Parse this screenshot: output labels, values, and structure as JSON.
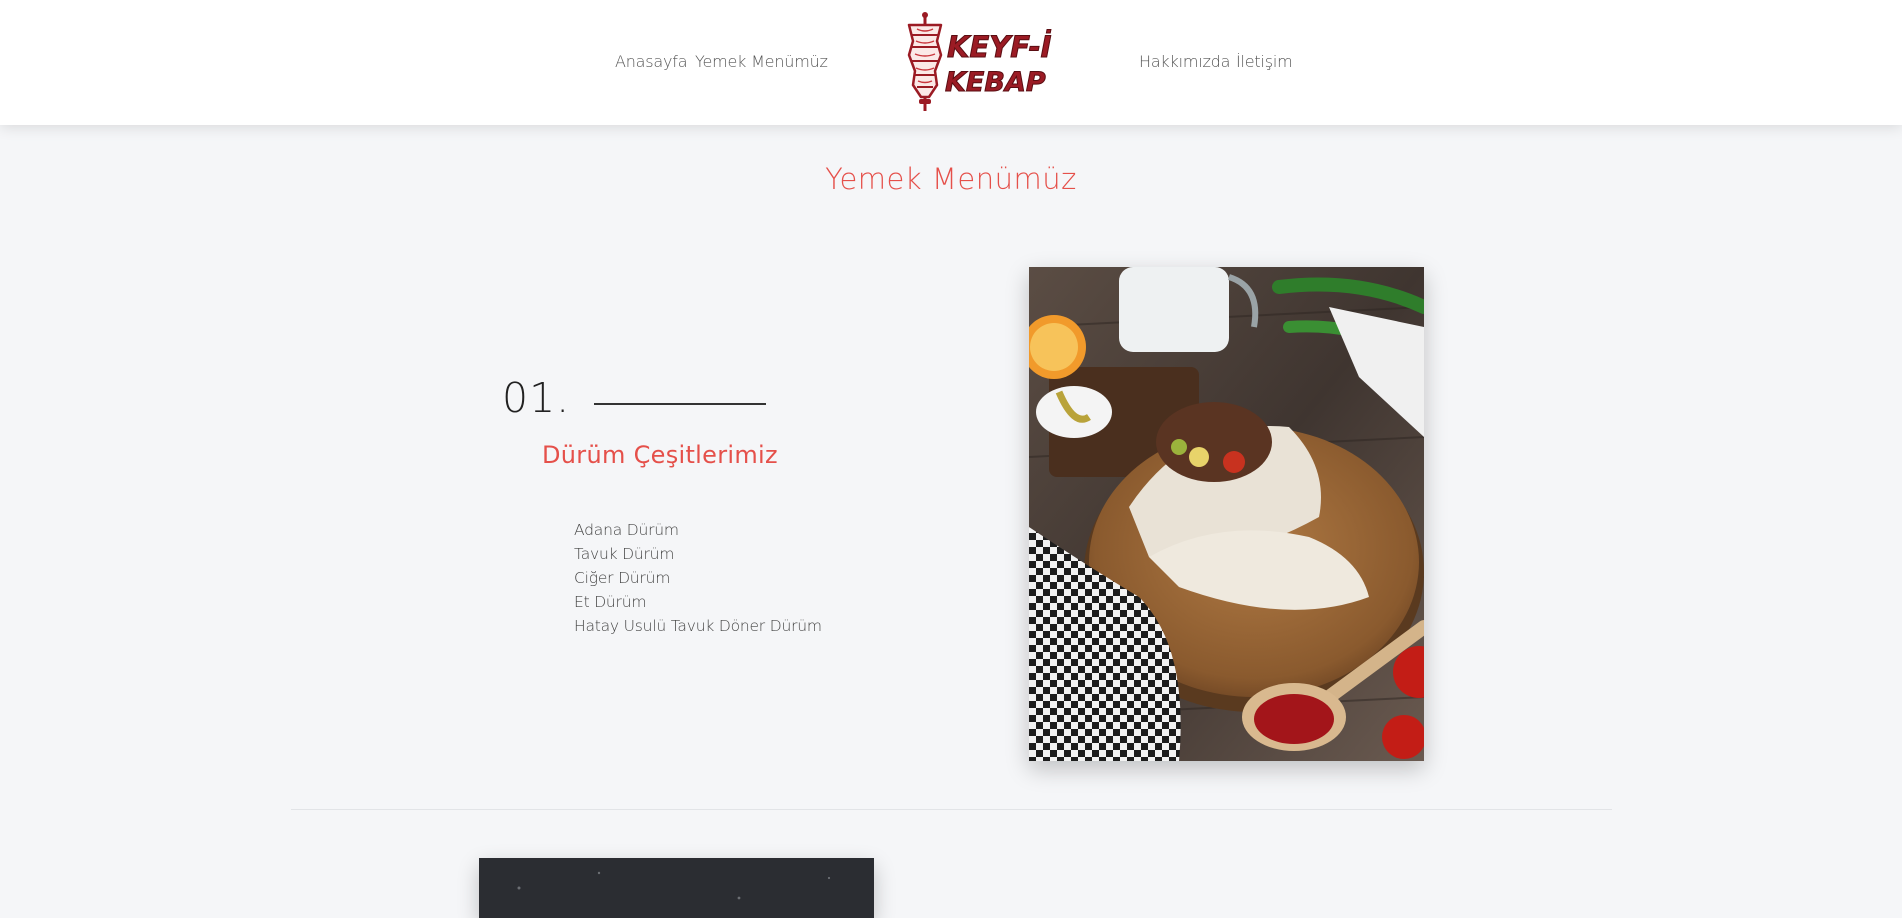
{
  "nav": {
    "left_items": [
      "Anasayfa",
      "Yemek Menümüz"
    ],
    "right_items": [
      "Hakkımızda",
      "İletişim"
    ]
  },
  "logo": {
    "line1": "KEYF-İ",
    "line2": "KEBAP",
    "icon": "doner-kebab-icon",
    "color": "#9b1b24"
  },
  "page_title": "Yemek Menümüz",
  "sections": [
    {
      "number": "01.",
      "heading": "Dürüm Çeşitlerimiz",
      "items": [
        "Adana Dürüm",
        "Tavuk Dürüm",
        "Ciğer Dürüm",
        "Et Dürüm",
        "Hatay Usulü Tavuk Döner Dürüm"
      ],
      "image": "durum-wraps-on-wooden-board-photo"
    }
  ],
  "colors": {
    "accent": "#e5504a",
    "background": "#f5f6f8",
    "header": "#ffffff"
  }
}
